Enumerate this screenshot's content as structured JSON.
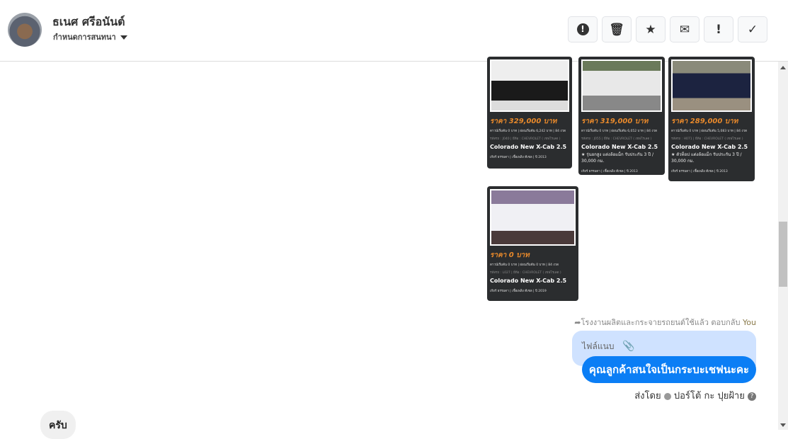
{
  "header": {
    "name": "ธเนศ ศรีอนันต์",
    "subtitle": "กำหนดการสนทนา",
    "toolbar": [
      {
        "icon": "alert-circle-icon",
        "glyph": "❗"
      },
      {
        "icon": "trash-icon",
        "glyph": "🗑"
      },
      {
        "icon": "star-icon",
        "glyph": "★"
      },
      {
        "icon": "envelope-icon",
        "glyph": "✉"
      },
      {
        "icon": "exclamation-icon",
        "glyph": "!"
      },
      {
        "icon": "check-icon",
        "glyph": "✓"
      }
    ]
  },
  "cards": [
    {
      "price": "ราคา 329,000 บาท",
      "terms": "ดาวน์เริ่มต้น 0 บาท | ผ่อนเริ่มต้น 6,242 บาท | 84 งวด",
      "meta": "รหัสรถ : J040 | ยี่ห้อ : CHEVROLET ( เชฟโรเลต )",
      "title": "Colorado New X-Cab 2.5",
      "desc": "",
      "foot": "เกียร์ ธรรมดา | เชื้อเพลิง ดีเซล | ปี 2013"
    },
    {
      "price": "ราคา 319,000 บาท",
      "terms": "ดาวน์เริ่มต้น 0 บาท | ผ่อนเริ่มต้น 6,052 บาท | 84 งวด",
      "meta": "รหัสรถ : J055 | ยี่ห้อ : CHEVROLET ( เชฟโรเลต )",
      "title": "Colorado New X-Cab 2.5",
      "desc": "★ รุ่นยกสูง แต่งล้อแม็ก รับประกัน 3 ปี / 30,000 กม.",
      "foot": "เกียร์ ธรรมดา | เชื้อเพลิง ดีเซล | ปี 2013"
    },
    {
      "price": "ราคา 289,000 บาท",
      "terms": "ดาวน์เริ่มต้น 0 บาท | ผ่อนเริ่มต้น 5,083 บาท | 84 งวด",
      "meta": "รหัสรถ : H071 | ยี่ห้อ : CHEVROLET ( เชฟโรเลต )",
      "title": "Colorado New X-Cab 2.5",
      "desc": "★ ตัวท็อป แต่งล้อแม็ก รับประกัน 3 ปี / 30,000 กม.",
      "foot": "เกียร์ ธรรมดา | เชื้อเพลิง ดีเซล | ปี 2013"
    },
    {
      "price": "ราคา 0 บาท",
      "terms": "ดาวน์เริ่มต้น 0 บาท | ผ่อนเริ่มต้น 0 บาท | 84 งวด",
      "meta": "รหัสรถ : L027 | ยี่ห้อ : CHEVROLET ( เชฟโรเลต )",
      "title": "Colorado New X-Cab 2.5",
      "desc": "",
      "foot": "เกียร์ ธรรมดา | เชื้อเพลิง ดีเซล | ปี 2019"
    }
  ],
  "reply": {
    "text": "โรงงานผลิตและกระจายรถยนต์ใช้แล้ว ตอบกลับ",
    "you": "You"
  },
  "attachment_label": "ไฟล์แนบ",
  "message": "คุณลูกค้าสนใจเป็นกระบะเชฟนะคะ",
  "sent_by": {
    "prefix": "ส่งโดย",
    "name": "ปอร์โต้ กะ ปุยฝ้าย"
  },
  "incoming": "ครับ"
}
